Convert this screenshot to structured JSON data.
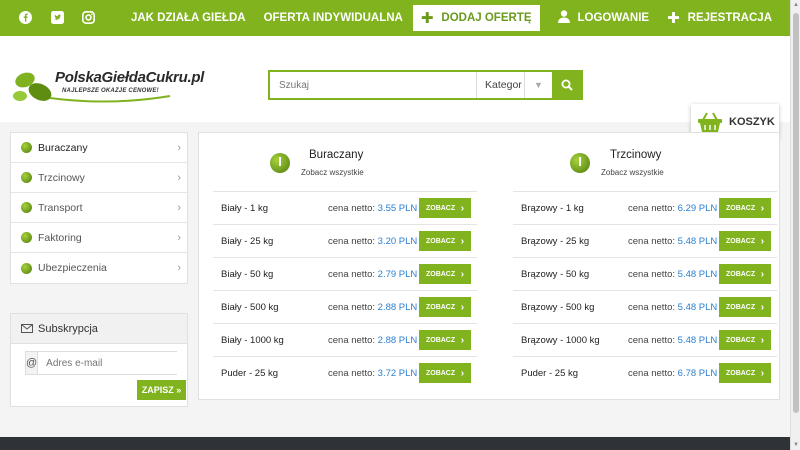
{
  "colors": {
    "brand": "#80b31e",
    "link": "#2a7fcf",
    "footer": "#2f3236"
  },
  "social": [
    "facebook-icon",
    "twitter-icon",
    "instagram-icon"
  ],
  "topnav": {
    "how_it_works": "JAK DZIAŁA GIEŁDA",
    "individual_offer": "OFERTA INDYWIDUALNA",
    "add_offer": "DODAJ OFERTĘ",
    "login": "LOGOWANIE",
    "register": "REJESTRACJA"
  },
  "logo": {
    "name": "PolskaGiełdaCukru.pl",
    "tagline": "NAJLEPSZE OKAZJE CENOWE!"
  },
  "search": {
    "placeholder": "Szukaj",
    "category": "Kategor"
  },
  "cart": {
    "label": "KOSZYK"
  },
  "sidebar": {
    "items": [
      {
        "label": "Buraczany"
      },
      {
        "label": "Trzcinowy"
      },
      {
        "label": "Transport"
      },
      {
        "label": "Faktoring"
      },
      {
        "label": "Ubezpieczenia"
      }
    ]
  },
  "subscription": {
    "title": "Subskrypcja",
    "placeholder": "Adres e-mail",
    "at": "@",
    "button": "ZAPISZ »"
  },
  "products": [
    {
      "title": "Buraczany",
      "see_all": "Zobacz wszystkie",
      "rows": [
        {
          "name": "Biały - 1 kg",
          "price_label": "cena netto:",
          "price": "3.55 PLN",
          "button": "ZOBACZ"
        },
        {
          "name": "Biały - 25 kg",
          "price_label": "cena netto:",
          "price": "3.20 PLN",
          "button": "ZOBACZ"
        },
        {
          "name": "Biały - 50 kg",
          "price_label": "cena netto:",
          "price": "2.79 PLN",
          "button": "ZOBACZ"
        },
        {
          "name": "Biały - 500 kg",
          "price_label": "cena netto:",
          "price": "2.88 PLN",
          "button": "ZOBACZ"
        },
        {
          "name": "Biały - 1000 kg",
          "price_label": "cena netto:",
          "price": "2.88 PLN",
          "button": "ZOBACZ"
        },
        {
          "name": "Puder - 25 kg",
          "price_label": "cena netto:",
          "price": "3.72 PLN",
          "button": "ZOBACZ"
        }
      ]
    },
    {
      "title": "Trzcinowy",
      "see_all": "Zobacz wszystkie",
      "rows": [
        {
          "name": "Brązowy - 1 kg",
          "price_label": "cena netto:",
          "price": "6.29 PLN",
          "button": "ZOBACZ"
        },
        {
          "name": "Brązowy - 25 kg",
          "price_label": "cena netto:",
          "price": "5.48 PLN",
          "button": "ZOBACZ"
        },
        {
          "name": "Brązowy - 50 kg",
          "price_label": "cena netto:",
          "price": "5.48 PLN",
          "button": "ZOBACZ"
        },
        {
          "name": "Brązowy - 500 kg",
          "price_label": "cena netto:",
          "price": "5.48 PLN",
          "button": "ZOBACZ"
        },
        {
          "name": "Brązowy - 1000 kg",
          "price_label": "cena netto:",
          "price": "5.48 PLN",
          "button": "ZOBACZ"
        },
        {
          "name": "Puder - 25 kg",
          "price_label": "cena netto:",
          "price": "6.78 PLN",
          "button": "ZOBACZ"
        }
      ]
    }
  ]
}
